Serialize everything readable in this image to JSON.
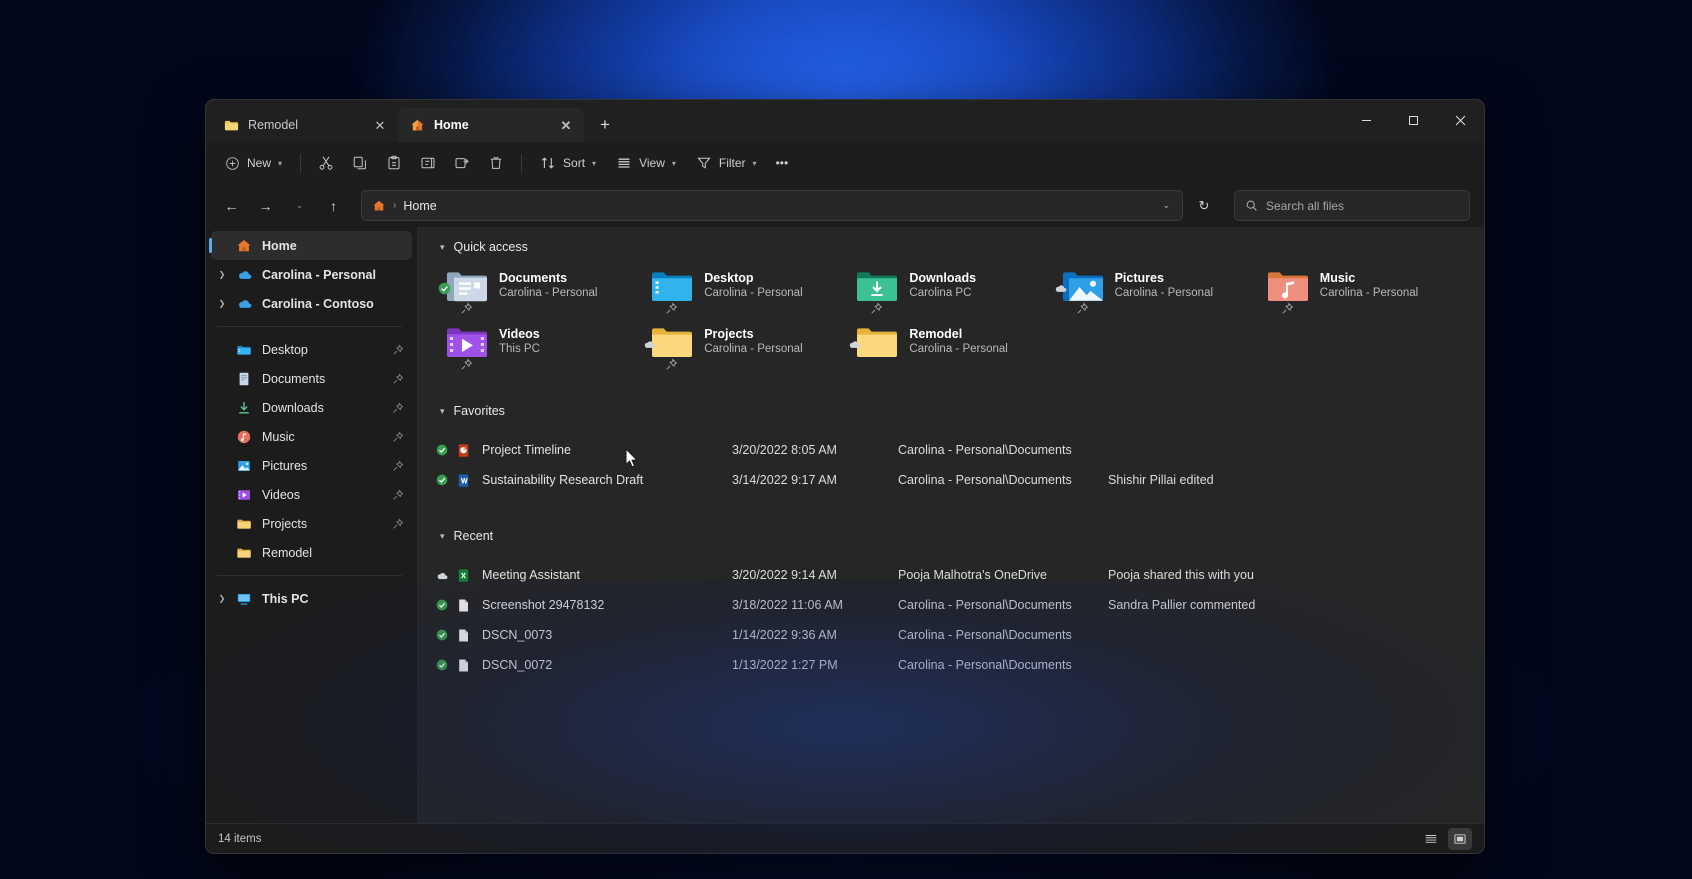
{
  "window": {
    "tabs": [
      {
        "label": "Remodel",
        "icon": "folder-icon",
        "active": false
      },
      {
        "label": "Home",
        "icon": "home-icon",
        "active": true
      }
    ],
    "new_tab_label": "+",
    "caption": {
      "minimize": "─",
      "maximize": "☐",
      "close": "✕"
    }
  },
  "toolbar": {
    "new_label": "New",
    "sort_label": "Sort",
    "view_label": "View",
    "filter_label": "Filter",
    "overflow_label": "•••",
    "icons": [
      "cut-icon",
      "copy-icon",
      "paste-icon",
      "rename-icon",
      "share-icon",
      "delete-icon"
    ]
  },
  "address": {
    "back": "←",
    "forward": "→",
    "recent": "⌄",
    "up": "↑",
    "crumb_root_icon": "home-icon",
    "crumb_separator": "›",
    "crumb_label": "Home",
    "expand": "⌄",
    "refresh": "↻"
  },
  "search": {
    "placeholder": "Search all files",
    "value": ""
  },
  "sidebar": {
    "top": [
      {
        "label": "Home",
        "icon": "home-icon",
        "expandable": false,
        "selected": true,
        "bold": true
      },
      {
        "label": "Carolina - Personal",
        "icon": "onedrive-icon",
        "expandable": true,
        "selected": false,
        "bold": true
      },
      {
        "label": "Carolina - Contoso",
        "icon": "onedrive-icon",
        "expandable": true,
        "selected": false,
        "bold": true
      }
    ],
    "pinned": [
      {
        "label": "Desktop",
        "icon": "desktop-folder-icon",
        "pinned": true
      },
      {
        "label": "Documents",
        "icon": "documents-folder-icon",
        "pinned": true
      },
      {
        "label": "Downloads",
        "icon": "downloads-icon",
        "pinned": true
      },
      {
        "label": "Music",
        "icon": "music-folder-icon",
        "pinned": true
      },
      {
        "label": "Pictures",
        "icon": "pictures-folder-icon",
        "pinned": true
      },
      {
        "label": "Videos",
        "icon": "videos-folder-icon",
        "pinned": true
      },
      {
        "label": "Projects",
        "icon": "folder-icon",
        "pinned": true
      },
      {
        "label": "Remodel",
        "icon": "folder-icon",
        "pinned": false
      }
    ],
    "bottom": [
      {
        "label": "This PC",
        "icon": "this-pc-icon",
        "expandable": true
      }
    ]
  },
  "main": {
    "quick_access": {
      "title": "Quick access",
      "items": [
        {
          "name": "Documents",
          "sub": "Carolina - Personal",
          "icon": "documents-folder-icon",
          "status": "synced",
          "pinned": true
        },
        {
          "name": "Desktop",
          "sub": "Carolina - Personal",
          "icon": "desktop-folder-icon",
          "status": "none",
          "pinned": true
        },
        {
          "name": "Downloads",
          "sub": "Carolina PC",
          "icon": "downloads-folder-icon",
          "status": "none",
          "pinned": true
        },
        {
          "name": "Pictures",
          "sub": "Carolina - Personal",
          "icon": "pictures-folder-icon",
          "status": "cloud",
          "pinned": true
        },
        {
          "name": "Music",
          "sub": "Carolina - Personal",
          "icon": "music-folder-icon",
          "status": "none",
          "pinned": true
        },
        {
          "name": "Videos",
          "sub": "This PC",
          "icon": "videos-folder-icon",
          "status": "none",
          "pinned": true
        },
        {
          "name": "Projects",
          "sub": "Carolina  - Personal",
          "icon": "folder-icon",
          "status": "cloud",
          "pinned": true
        },
        {
          "name": "Remodel",
          "sub": "Carolina - Personal",
          "icon": "folder-icon",
          "status": "cloud",
          "pinned": false
        }
      ]
    },
    "favorites": {
      "title": "Favorites",
      "rows": [
        {
          "name": "Project Timeline",
          "date": "3/20/2022 8:05 AM",
          "location": "Carolina - Personal\\Documents",
          "activity": "",
          "icon": "powerpoint-icon",
          "status": "synced"
        },
        {
          "name": "Sustainability Research Draft",
          "date": "3/14/2022 9:17 AM",
          "location": "Carolina - Personal\\Documents",
          "activity": "Shishir Pillai edited",
          "icon": "word-icon",
          "status": "synced"
        }
      ]
    },
    "recent": {
      "title": "Recent",
      "rows": [
        {
          "name": "Meeting Assistant",
          "date": "3/20/2022 9:14 AM",
          "location": "Pooja Malhotra's OneDrive",
          "activity": "Pooja shared this with you",
          "icon": "excel-icon",
          "status": "cloud"
        },
        {
          "name": "Screenshot 29478132",
          "date": "3/18/2022 11:06 AM",
          "location": "Carolina - Personal\\Documents",
          "activity": "Sandra Pallier commented",
          "icon": "image-file-icon",
          "status": "synced"
        },
        {
          "name": "DSCN_0073",
          "date": "1/14/2022 9:36 AM",
          "location": "Carolina - Personal\\Documents",
          "activity": "",
          "icon": "image-file-icon",
          "status": "synced"
        },
        {
          "name": "DSCN_0072",
          "date": "1/13/2022 1:27 PM",
          "location": "Carolina - Personal\\Documents",
          "activity": "",
          "icon": "image-file-icon",
          "status": "synced"
        }
      ]
    }
  },
  "statusbar": {
    "item_count": "14 items",
    "view_details_icon": "details-view-icon",
    "view_tiles_icon": "tiles-view-icon"
  },
  "colors": {
    "accent": "#5aaaf2",
    "window_bg": "#1c1c1c",
    "content_bg": "#262626",
    "folder_yellow": "#f2c44c",
    "onedrive_blue": "#3aa0e8",
    "sync_green": "#4caf50"
  }
}
